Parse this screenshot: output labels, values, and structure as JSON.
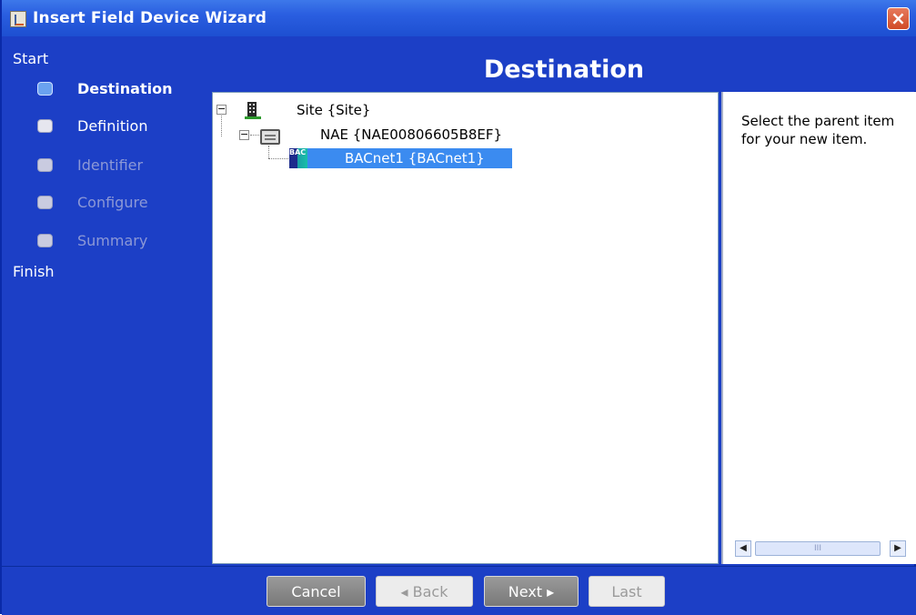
{
  "window": {
    "title": "Insert Field Device Wizard",
    "close_symbol": "×",
    "app_icon": "java-cup-icon"
  },
  "sidebar": {
    "start_label": "Start",
    "finish_label": "Finish",
    "steps": [
      {
        "label": "Destination",
        "state": "active"
      },
      {
        "label": "Definition",
        "state": "enabled"
      },
      {
        "label": "Identifier",
        "state": "disabled"
      },
      {
        "label": "Configure",
        "state": "disabled"
      },
      {
        "label": "Summary",
        "state": "disabled"
      }
    ]
  },
  "main": {
    "header": "Destination",
    "tree": {
      "site": {
        "label": "Site {Site}",
        "icon": "building-icon",
        "expander": "−"
      },
      "nae": {
        "label": "NAE {NAE00806605B8EF}",
        "icon": "server-icon",
        "expander": "−"
      },
      "bacnet": {
        "label": "BACnet1 {BACnet1}",
        "icon": "bacnet-icon",
        "icon_text": "BAC",
        "selected": true
      }
    },
    "help_text": "Select the parent item for your new item.",
    "scroll_thumb_grip": "III"
  },
  "footer": {
    "cancel_label": "Cancel",
    "back_label": "◂ Back",
    "next_label": "Next ▸",
    "last_label": "Last"
  },
  "colors": {
    "background_blue": "#1c3fc6",
    "selection_blue": "#3b8bf0",
    "close_red": "#d04a26"
  }
}
